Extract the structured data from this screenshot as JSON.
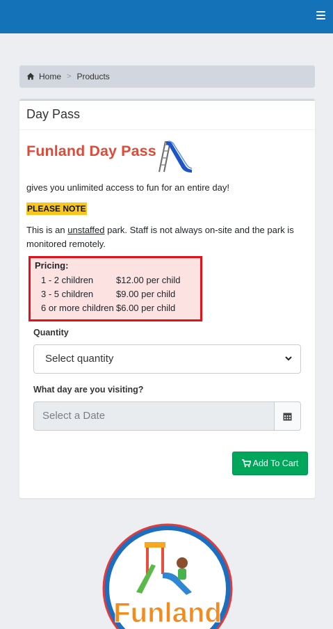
{
  "nav": {
    "menu_icon": "hamburger-icon"
  },
  "breadcrumb": {
    "home_icon": "home-icon",
    "home": "Home",
    "separator": ">",
    "current": "Products"
  },
  "card": {
    "header": "Day Pass",
    "product_title": "Funland Day Pass",
    "description": "gives you unlimited access to fun for an entire day!",
    "note": "PLEASE NOTE",
    "unstaffed_before": "This is an ",
    "unstaffed_word": "unstaffed",
    "unstaffed_after": " park. Staff is not always on-site and the park is monitored remotely.",
    "pricing": {
      "title": "Pricing:",
      "rows": [
        {
          "group": "1 - 2 children",
          "price": "$12.00 per child"
        },
        {
          "group": "3 - 5 children",
          "price": "$9.00 per child"
        },
        {
          "group": "6 or more children",
          "price": "$6.00 per child"
        }
      ]
    },
    "quantity_label": "Quantity",
    "quantity_selected": "Select quantity",
    "date_label": "What day are you visiting?",
    "date_placeholder": "Select a Date",
    "add_to_cart": "Add To Cart"
  },
  "logo": {
    "text": "Funland"
  },
  "colors": {
    "navbar": "#1472b9",
    "title": "#dd4b39",
    "note_bg": "#f6c623",
    "pricing_border": "#e3121a",
    "cart_button": "#00a65a"
  }
}
